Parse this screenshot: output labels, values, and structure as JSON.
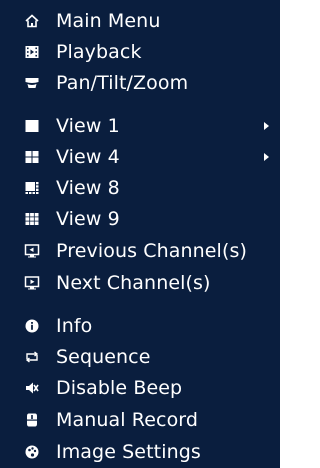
{
  "menu": {
    "items": [
      {
        "label": "Main Menu",
        "icon": "home-icon"
      },
      {
        "label": "Playback",
        "icon": "playback-icon"
      },
      {
        "label": "Pan/Tilt/Zoom",
        "icon": "ptz-icon"
      },
      {
        "label": "View 1",
        "icon": "view-1-icon",
        "submenu": true
      },
      {
        "label": "View 4",
        "icon": "view-4-icon",
        "submenu": true
      },
      {
        "label": "View 8",
        "icon": "view-8-icon"
      },
      {
        "label": "View 9",
        "icon": "view-9-icon"
      },
      {
        "label": "Previous Channel(s)",
        "icon": "previous-channel-icon"
      },
      {
        "label": "Next Channel(s)",
        "icon": "next-channel-icon"
      },
      {
        "label": "Info",
        "icon": "info-icon"
      },
      {
        "label": "Sequence",
        "icon": "sequence-icon"
      },
      {
        "label": "Disable Beep",
        "icon": "mute-icon"
      },
      {
        "label": "Manual Record",
        "icon": "record-icon"
      },
      {
        "label": "Image Settings",
        "icon": "image-settings-icon"
      }
    ]
  },
  "colors": {
    "background": "#0a1e3e",
    "text": "#ffffff"
  }
}
